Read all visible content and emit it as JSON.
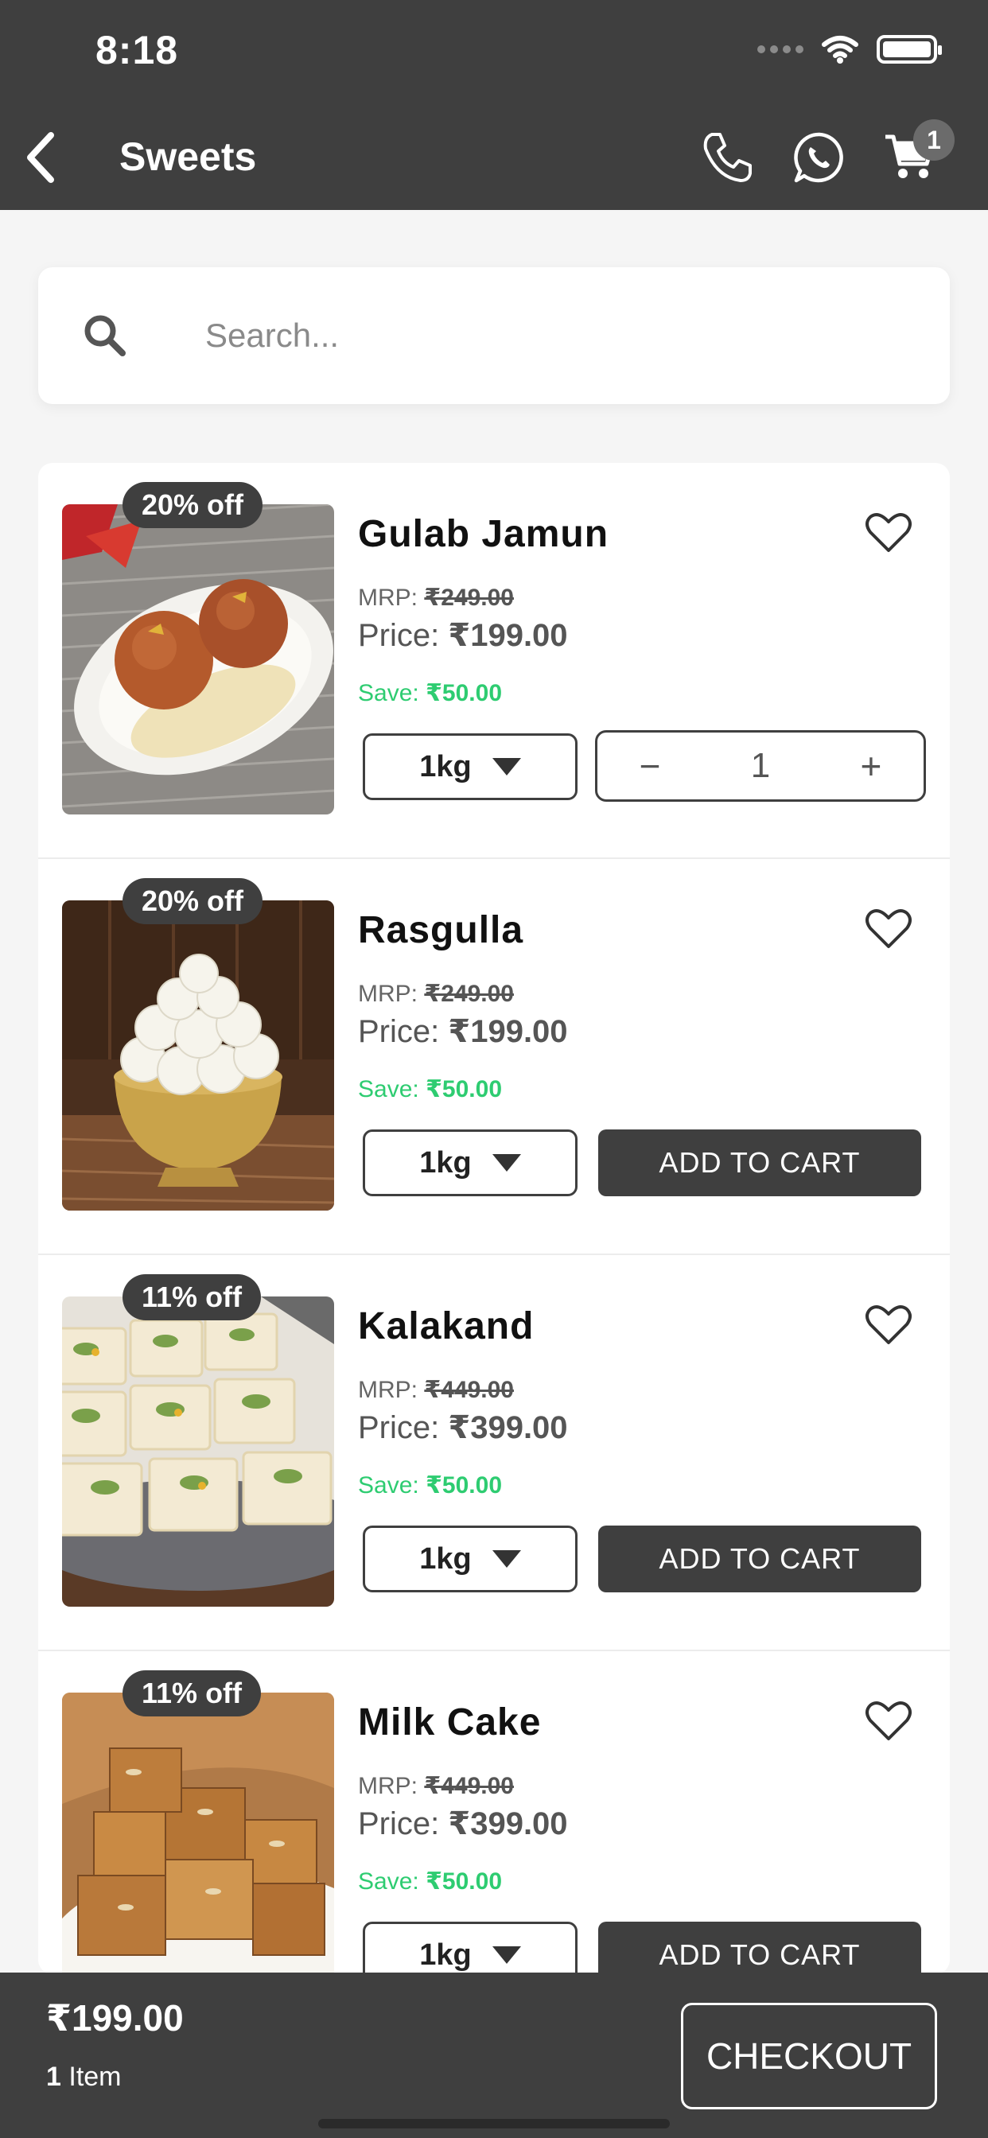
{
  "status_bar": {
    "time": "8:18"
  },
  "header": {
    "title": "Sweets",
    "cart_count": "1"
  },
  "search": {
    "placeholder": "Search..."
  },
  "products": [
    {
      "name": "Gulab Jamun",
      "discount": "20% off",
      "mrp_label": "MRP:",
      "mrp": "₹249.00",
      "price_label": "Price:",
      "price": "₹199.00",
      "save_label": "Save:",
      "save": "₹50.00",
      "weight": "1kg",
      "in_cart": true,
      "qty": "1"
    },
    {
      "name": "Rasgulla",
      "discount": "20% off",
      "mrp_label": "MRP:",
      "mrp": "₹249.00",
      "price_label": "Price:",
      "price": "₹199.00",
      "save_label": "Save:",
      "save": "₹50.00",
      "weight": "1kg",
      "in_cart": false,
      "add_label": "ADD TO CART"
    },
    {
      "name": "Kalakand",
      "discount": "11% off",
      "mrp_label": "MRP:",
      "mrp": "₹449.00",
      "price_label": "Price:",
      "price": "₹399.00",
      "save_label": "Save:",
      "save": "₹50.00",
      "weight": "1kg",
      "in_cart": false,
      "add_label": "ADD TO CART"
    },
    {
      "name": "Milk Cake",
      "discount": "11% off",
      "mrp_label": "MRP:",
      "mrp": "₹449.00",
      "price_label": "Price:",
      "price": "₹399.00",
      "save_label": "Save:",
      "save": "₹50.00",
      "weight": "1kg",
      "in_cart": false,
      "add_label": "ADD TO CART"
    }
  ],
  "cart_bar": {
    "total": "₹199.00",
    "item_count": "1",
    "item_label": "Item",
    "checkout_label": "CHECKOUT"
  },
  "colors": {
    "bar": "#3f3f3f",
    "save_green": "#2ecc71"
  }
}
